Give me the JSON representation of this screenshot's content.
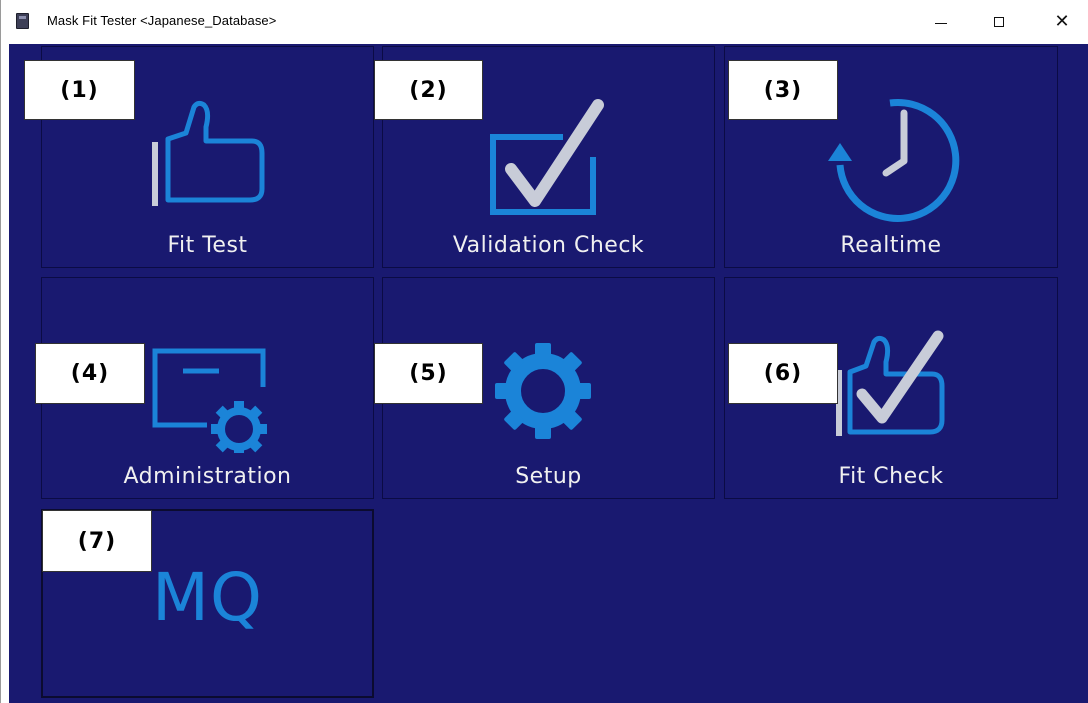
{
  "window": {
    "title": "Mask Fit Tester <Japanese_Database>",
    "controls": {
      "minimize": "minimize-icon",
      "maximize": "maximize-icon",
      "close": "close-icon"
    }
  },
  "colors": {
    "background": "#191970",
    "icon_blue": "#1b84d8",
    "icon_grey": "#c8ccd8",
    "label": "#f0f0f0"
  },
  "tiles": [
    {
      "badge": "(1)",
      "label": "Fit Test",
      "icon": "thumbs-up-icon"
    },
    {
      "badge": "(2)",
      "label": "Validation Check",
      "icon": "checkbox-icon"
    },
    {
      "badge": "(3)",
      "label": "Realtime",
      "icon": "clock-icon"
    },
    {
      "badge": "(4)",
      "label": "Administration",
      "icon": "admin-settings-icon"
    },
    {
      "badge": "(5)",
      "label": "Setup",
      "icon": "gear-icon"
    },
    {
      "badge": "(6)",
      "label": "Fit Check",
      "icon": "thumbs-up-check-icon"
    },
    {
      "badge": "(7)",
      "label": "MQ",
      "icon": "mq-text-icon"
    }
  ]
}
